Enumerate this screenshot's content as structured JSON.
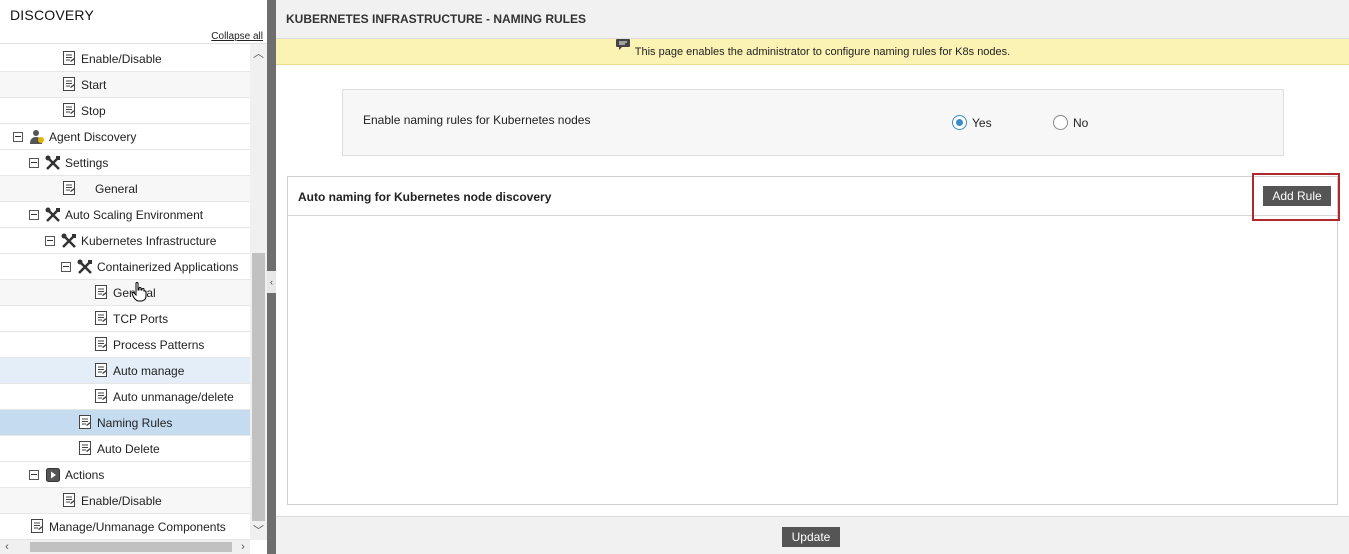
{
  "sidebar": {
    "title": "DISCOVERY",
    "collapse_all": "Collapse all",
    "items": [
      {
        "label": "Enable/Disable",
        "icon": "page-icon"
      },
      {
        "label": "Start",
        "icon": "page-icon"
      },
      {
        "label": "Stop",
        "icon": "page-icon"
      },
      {
        "label": "Agent Discovery",
        "icon": "agent-icon"
      },
      {
        "label": "Settings",
        "icon": "tools-icon"
      },
      {
        "label": "General",
        "icon": "page-icon"
      },
      {
        "label": "Auto Scaling Environment",
        "icon": "tools-icon"
      },
      {
        "label": "Kubernetes Infrastructure",
        "icon": "tools-icon"
      },
      {
        "label": "Containerized Applications",
        "icon": "tools-icon"
      },
      {
        "label": "General",
        "icon": "page-icon"
      },
      {
        "label": "TCP Ports",
        "icon": "page-icon"
      },
      {
        "label": "Process Patterns",
        "icon": "page-icon"
      },
      {
        "label": "Auto manage",
        "icon": "page-icon"
      },
      {
        "label": "Auto unmanage/delete",
        "icon": "page-icon"
      },
      {
        "label": "Naming Rules",
        "icon": "page-icon"
      },
      {
        "label": "Auto Delete",
        "icon": "page-icon"
      },
      {
        "label": "Actions",
        "icon": "actions-icon"
      },
      {
        "label": "Enable/Disable",
        "icon": "page-icon"
      },
      {
        "label": "Manage/Unmanage Components",
        "icon": "page-icon"
      }
    ]
  },
  "main": {
    "title": "KUBERNETES INFRASTRUCTURE - NAMING RULES",
    "info": "This page enables the administrator to configure naming rules for K8s nodes.",
    "setting": {
      "label": "Enable naming rules for Kubernetes nodes",
      "options": [
        {
          "label": "Yes",
          "checked": true
        },
        {
          "label": "No",
          "checked": false
        }
      ]
    },
    "rules_panel": {
      "title": "Auto naming for Kubernetes node discovery",
      "add_button": "Add Rule"
    },
    "update_button": "Update"
  },
  "colors": {
    "info_bar": "#fbf3b4",
    "selected_row": "#c5dbf0",
    "highlight_border": "#b0272c",
    "button": "#555555"
  }
}
